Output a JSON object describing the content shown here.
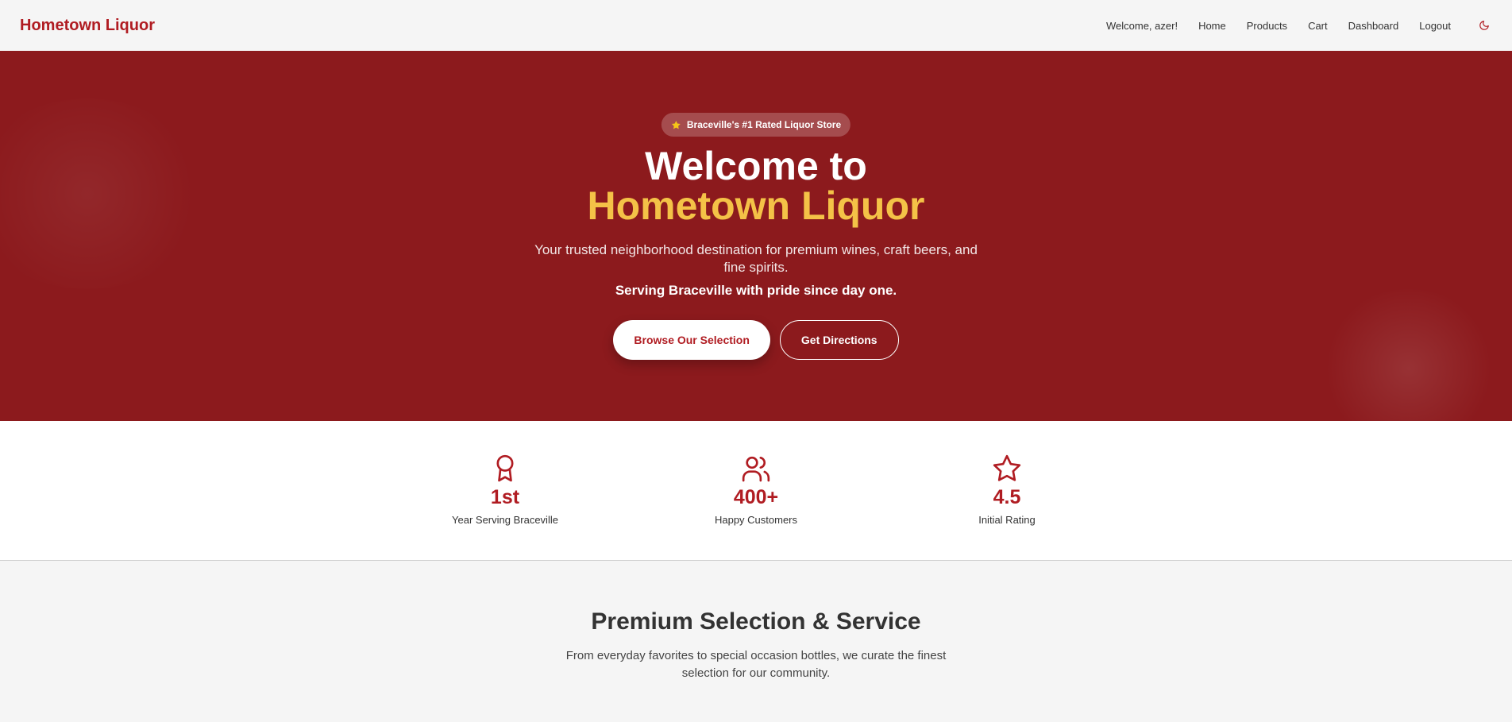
{
  "header": {
    "brand": "Hometown Liquor",
    "welcome": "Welcome, azer!",
    "nav": [
      "Home",
      "Products",
      "Cart",
      "Dashboard",
      "Logout"
    ],
    "theme_icon": "moon-icon"
  },
  "hero": {
    "badge": "Braceville's #1 Rated Liquor Store",
    "title_line1": "Welcome to",
    "title_line2": "Hometown Liquor",
    "subtitle": "Your trusted neighborhood destination for premium wines, craft beers, and fine spirits.",
    "tagline": "Serving Braceville with pride since day one.",
    "primary_button": "Browse Our Selection",
    "secondary_button": "Get Directions"
  },
  "stats": [
    {
      "icon": "award-icon",
      "value": "1st",
      "label": "Year Serving Braceville"
    },
    {
      "icon": "users-icon",
      "value": "400+",
      "label": "Happy Customers"
    },
    {
      "icon": "star-icon",
      "value": "4.5",
      "label": "Initial Rating"
    }
  ],
  "section": {
    "title": "Premium Selection & Service",
    "text": "From everyday favorites to special occasion bottles, we curate the finest selection for our community."
  },
  "colors": {
    "brand": "#b01c22",
    "hero_bg": "#8c1a1d",
    "accent_gold": "#f4c247"
  }
}
